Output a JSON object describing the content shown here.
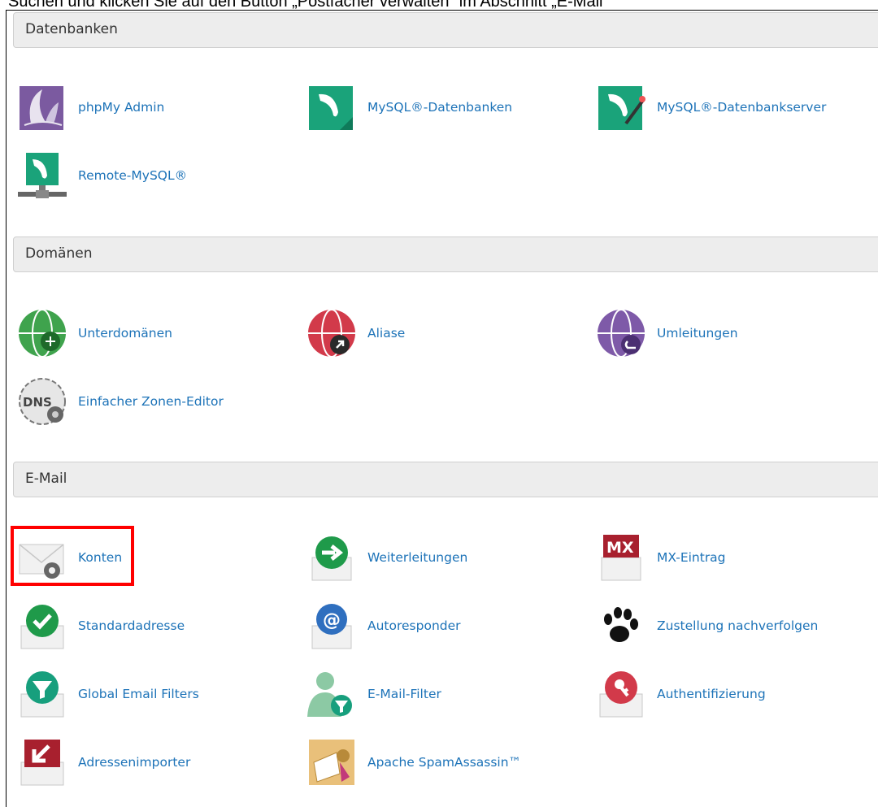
{
  "caption": "Suchen und klicken Sie auf den Button „Postfächer verwalten“ im Abschnitt „E-Mail“",
  "sections": [
    {
      "title": "Datenbanken",
      "items": [
        {
          "label": "phpMy Admin",
          "icon": "phpmyadmin-icon"
        },
        {
          "label": "MySQL®-Datenbanken",
          "icon": "mysql-databases-icon"
        },
        {
          "label": "MySQL®-Datenbankserver",
          "icon": "mysql-database-wizard-icon"
        },
        {
          "label": "Remote-MySQL®",
          "icon": "remote-mysql-icon"
        }
      ]
    },
    {
      "title": "Domänen",
      "items": [
        {
          "label": "Unterdomänen",
          "icon": "subdomains-icon"
        },
        {
          "label": "Aliase",
          "icon": "aliases-icon"
        },
        {
          "label": "Umleitungen",
          "icon": "redirects-icon"
        },
        {
          "label": "Einfacher Zonen-Editor",
          "icon": "dns-zone-editor-icon"
        }
      ]
    },
    {
      "title": "E-Mail",
      "items": [
        {
          "label": "Konten",
          "icon": "email-accounts-icon"
        },
        {
          "label": "Weiterleitungen",
          "icon": "forwarders-icon"
        },
        {
          "label": "MX-Eintrag",
          "icon": "mx-entry-icon"
        },
        {
          "label": "Standardadresse",
          "icon": "default-address-icon"
        },
        {
          "label": "Autoresponder",
          "icon": "autoresponder-icon"
        },
        {
          "label": "Zustellung nachverfolgen",
          "icon": "track-delivery-icon"
        },
        {
          "label": "Global Email Filters",
          "icon": "global-email-filters-icon"
        },
        {
          "label": "E-Mail-Filter",
          "icon": "email-filter-icon"
        },
        {
          "label": "Authentifizierung",
          "icon": "authentication-icon"
        },
        {
          "label": "Adressenimporter",
          "icon": "address-importer-icon"
        },
        {
          "label": "Apache SpamAssassin™",
          "icon": "spamassassin-icon"
        }
      ]
    }
  ],
  "colors": {
    "link": "#1d73b8",
    "header_bg": "#ededed",
    "highlight": "#ff0000"
  }
}
